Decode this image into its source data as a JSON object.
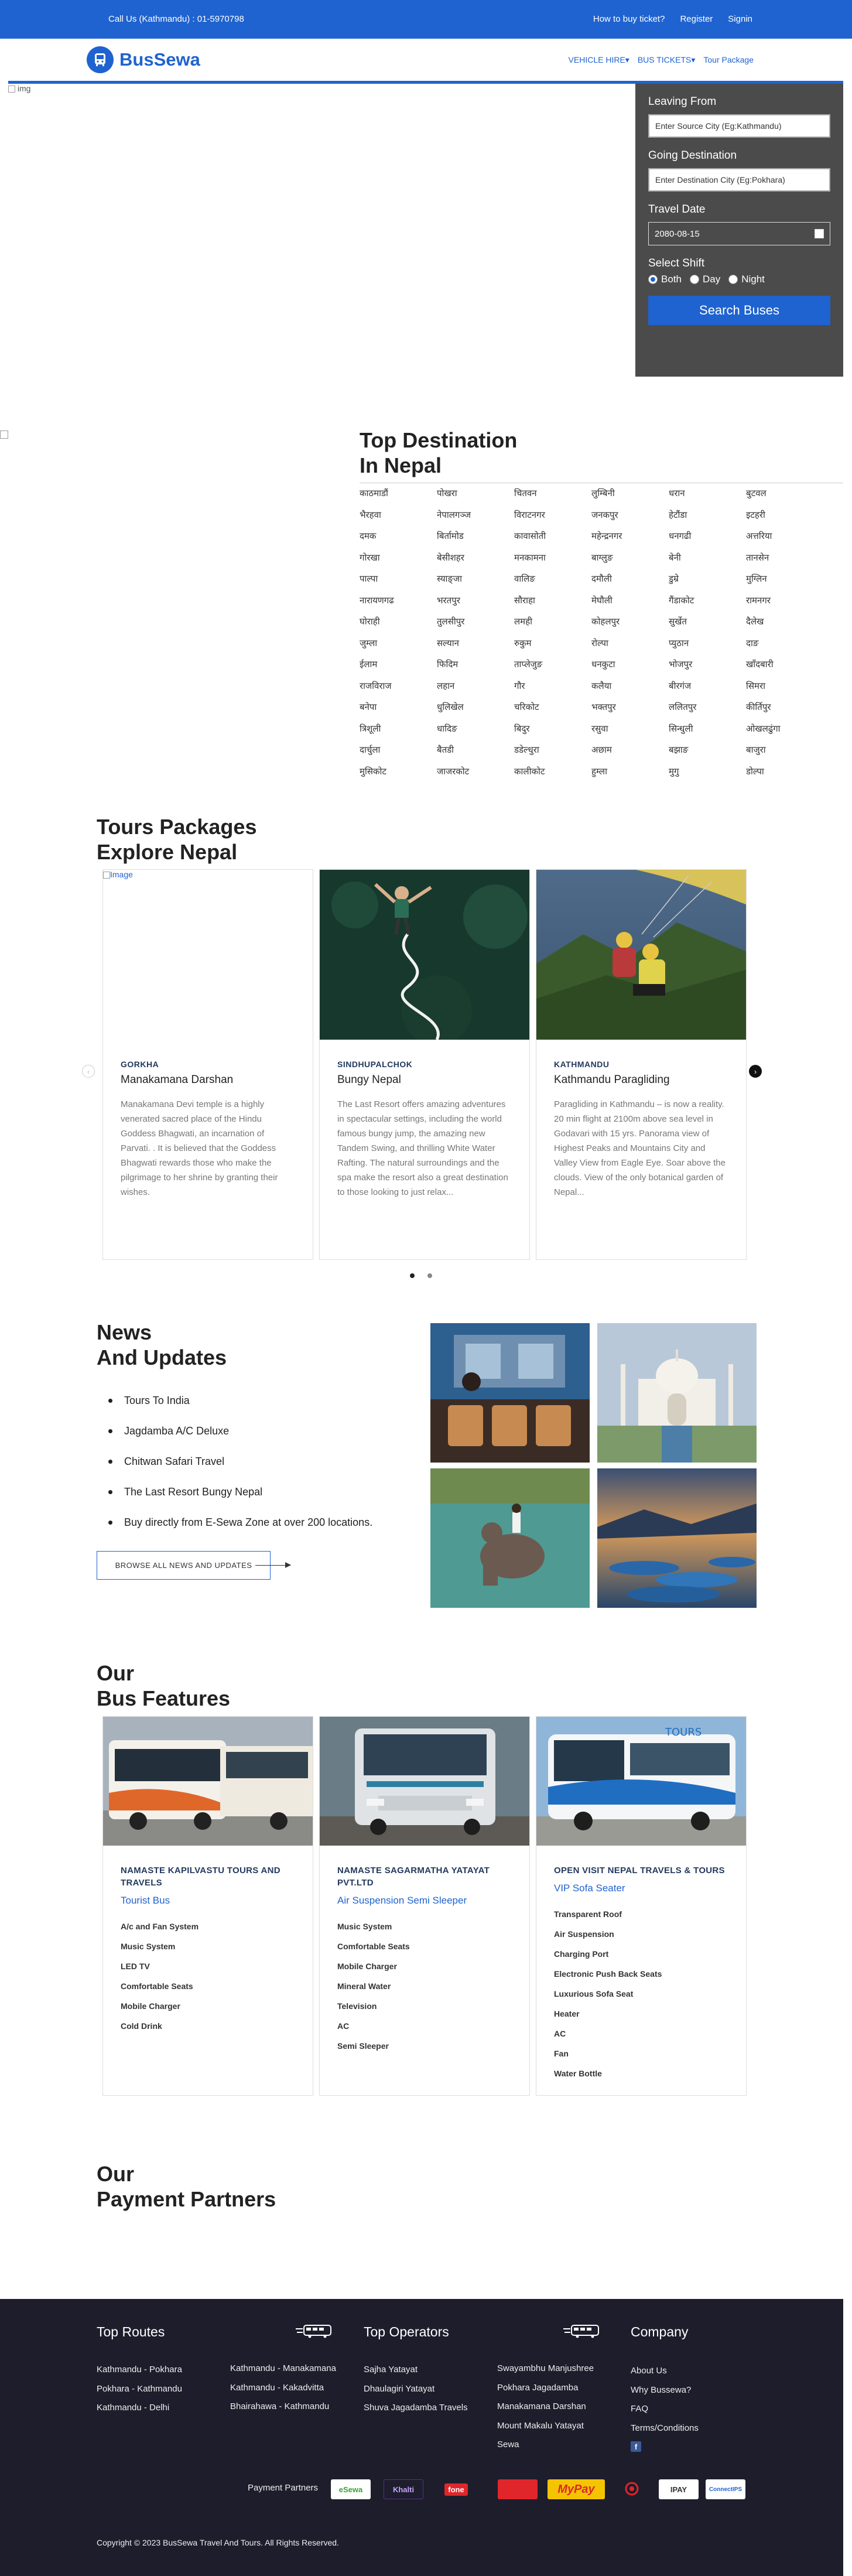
{
  "topbar": {
    "call": "Call Us (Kathmandu) : 01-5970798",
    "how_to_buy": "How to buy ticket?",
    "register": "Register",
    "signin": "Signin"
  },
  "navbar": {
    "brand": "BusSewa",
    "vehicle_hire": "VEHICLE HIRE▾",
    "bus_tickets": "BUS TICKETS▾",
    "tour_package": "Tour Package"
  },
  "hero": {
    "img_alt": "img"
  },
  "search": {
    "leaving_label": "Leaving From",
    "leaving_placeholder": "Enter Source City (Eg:Kathmandu)",
    "going_label": "Going Destination",
    "going_placeholder": "Enter Destination City (Eg:Pokhara)",
    "date_label": "Travel Date",
    "date_value": "2080-08-15",
    "shift_label": "Select Shift",
    "shifts": [
      "Both",
      "Day",
      "Night"
    ],
    "button": "Search Buses"
  },
  "destinations": {
    "title_line1": "Top Destination",
    "title_line2": "In Nepal",
    "items": [
      "काठमाडौं",
      "पोखरा",
      "चितवन",
      "लुम्बिनी",
      "धरान",
      "बुटवल",
      "भैरहवा",
      "नेपालगञ्ज",
      "विराटनगर",
      "जनकपुर",
      "हेटौंडा",
      "इटहरी",
      "दमक",
      "बिर्तामोड",
      "कावासोती",
      "महेन्द्रनगर",
      "धनगढी",
      "अत्तरिया",
      "गोरखा",
      "बेसीशहर",
      "मनकामना",
      "बाग्लुङ",
      "बेनी",
      "तानसेन",
      "पाल्पा",
      "स्याङ्जा",
      "वालिङ",
      "दमौली",
      "डुम्रे",
      "मुग्लिन",
      "नारायणगढ",
      "भरतपुर",
      "सौराहा",
      "मेघौली",
      "गैंडाकोट",
      "रामनगर",
      "घोराही",
      "तुलसीपुर",
      "लमही",
      "कोहलपुर",
      "सुर्खेत",
      "दैलेख",
      "जुम्ला",
      "सल्यान",
      "रुकुम",
      "रोल्पा",
      "प्युठान",
      "दाङ",
      "ईलाम",
      "फिदिम",
      "ताप्लेजुङ",
      "धनकुटा",
      "भोजपुर",
      "खाँदबारी",
      "राजविराज",
      "लहान",
      "गौर",
      "कलैया",
      "बीरगंज",
      "सिमरा",
      "बनेपा",
      "धुलिखेल",
      "चरिकोट",
      "भक्तपुर",
      "ललितपुर",
      "कीर्तिपुर",
      "त्रिशूली",
      "धादिङ",
      "बिदुर",
      "रसुवा",
      "सिन्धुली",
      "ओखलढुंगा",
      "दार्चुला",
      "बैतडी",
      "डडेल्धुरा",
      "अछाम",
      "बझाङ",
      "बाजुरा",
      "मुसिकोट",
      "जाजरकोट",
      "कालीकोट",
      "हुम्ला",
      "मुगु",
      "डोल्पा"
    ]
  },
  "tours": {
    "title_line1": "Tours Packages",
    "title_line2": "Explore Nepal",
    "cards": [
      {
        "img_alt": "Image",
        "location": "GORKHA",
        "name": "Manakamana Darshan",
        "desc": "Manakamana Devi temple is a highly venerated sacred place of the Hindu Goddess Bhagwati, an incarnation of Parvati. . It is believed that the Goddess Bhagwati rewards those who make the pilgrimage to her shrine by granting their wishes."
      },
      {
        "location": "SINDHUPALCHOK",
        "name": "Bungy Nepal",
        "desc": "The Last Resort offers amazing adventures in spectacular settings, including the world famous bungy jump, the amazing new Tandem Swing, and thrilling White Water Rafting. The natural surroundings and the spa make the resort also a great destination to those looking to just relax..."
      },
      {
        "location": "KATHMANDU",
        "name": "Kathmandu Paragliding",
        "desc": "Paragliding in Kathmandu – is now a reality. 20 min flight at 2100m above sea level in Godavari with 15 yrs. Panorama view of Highest Peaks and Mountains City and Valley View from Eagle Eye. Soar above the clouds. View of the only botanical garden of Nepal..."
      }
    ]
  },
  "news": {
    "title_line1": "News",
    "title_line2": "And Updates",
    "items": [
      "Tours To India",
      "Jagdamba A/C Deluxe",
      "Chitwan Safari Travel",
      "The Last Resort Bungy Nepal",
      "Buy directly from E-Sewa Zone at over 200 locations."
    ],
    "button": "BROWSE ALL NEWS AND UPDATES"
  },
  "features": {
    "title_line1": "Our",
    "title_line2": "Bus Features",
    "cards": [
      {
        "company": "NAMASTE KAPILVASTU TOURS AND TRAVELS",
        "type": "Tourist Bus",
        "items": [
          "A/c and Fan System",
          "Music System",
          "LED TV",
          "Comfortable Seats",
          "Mobile Charger",
          "Cold Drink"
        ]
      },
      {
        "company": "NAMASTE SAGARMATHA YATAYAT PVT.LTD",
        "type": "Air Suspension Semi Sleeper",
        "items": [
          "Music System",
          "Comfortable Seats",
          "Mobile Charger",
          "Mineral Water",
          "Television",
          "AC",
          "Semi Sleeper"
        ]
      },
      {
        "company": "OPEN VISIT NEPAL TRAVELS & TOURS",
        "type": "VIP Sofa Seater",
        "items": [
          "Transparent Roof",
          "Air Suspension",
          "Charging Port",
          "Electronic Push Back Seats",
          "Luxurious Sofa Seat",
          "Heater",
          "AC",
          "Fan",
          "Water Bottle"
        ]
      }
    ]
  },
  "payment": {
    "title_line1": "Our",
    "title_line2": "Payment Partners"
  },
  "footer": {
    "top_routes": "Top Routes",
    "routes_col1": [
      "Kathmandu - Pokhara",
      "Pokhara - Kathmandu",
      "Kathmandu - Delhi"
    ],
    "routes_col2": [
      "Kathmandu - Manakamana",
      "Kathmandu - Kakadvitta",
      "Bhairahawa - Kathmandu"
    ],
    "top_operators": "Top Operators",
    "operators_col1": [
      "Sajha Yatayat",
      "Dhaulagiri Yatayat",
      "Shuva Jagadamba Travels"
    ],
    "operators_col2": [
      "Swayambhu Manjushree",
      "Pokhara Jagadamba",
      "Manakamana Darshan",
      "Mount Makalu Yatayat",
      "Sewa"
    ],
    "company": "Company",
    "company_links": [
      "About Us",
      "Why Bussewa?",
      "FAQ",
      "Terms/Conditions"
    ],
    "payment_partners_label": "Payment Partners",
    "payment_logos": [
      "eSewa",
      "Khalti",
      "fone",
      "",
      "MyPay",
      "",
      "IPAY",
      "ConnectIPS"
    ],
    "copyright": "Copyright © 2023 BusSewa Travel And Tours. All Rights Reserved."
  },
  "colors": {
    "brand_blue": "#1f63d0",
    "footer_bg": "#1d1d2c",
    "panel_gray": "#4b4b4b",
    "navy_text": "#23395d"
  }
}
